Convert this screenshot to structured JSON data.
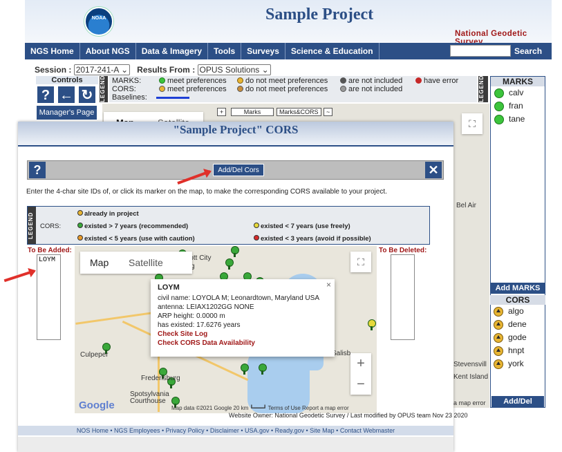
{
  "header": {
    "title": "Sample Project",
    "subtitle": "National Geodetic Survey",
    "logo_text": "NOAA"
  },
  "nav": {
    "items": [
      "NGS Home",
      "About NGS",
      "Data & Imagery",
      "Tools",
      "Surveys",
      "Science & Education"
    ],
    "search_label": "Search"
  },
  "session": {
    "label": "Session :",
    "value": "2017-241-A",
    "results_label": "Results From :",
    "results_value": "OPUS Solutions"
  },
  "controls": {
    "title": "Controls",
    "help": "?",
    "back": "←",
    "refresh": "↻",
    "manager": "Manager's Page"
  },
  "legend": {
    "strip": "LEGEND",
    "marks_label": "MARKS:",
    "cors_label": "CORS:",
    "baselines_label": "Baselines:",
    "meet": "meet preferences",
    "not_meet": "do not meet preferences",
    "not_included": "are not included",
    "have_error": "have error"
  },
  "bg_map": {
    "chips": [
      "+",
      "Marks",
      "Marks&CORS",
      "~"
    ],
    "map_tab": "Map",
    "satellite_tab": "Satellite",
    "labels": [
      "Bel Air",
      "Stevensvill",
      "Kent Island"
    ],
    "report": "a map error"
  },
  "marks_panel": {
    "marks_title": "MARKS",
    "marks": [
      "calv",
      "fran",
      "tane"
    ],
    "add_marks": "Add MARKS",
    "cors_title": "CORS",
    "cors": [
      "algo",
      "dene",
      "gode",
      "hnpt",
      "york"
    ],
    "add_del_cors": "Add/Del CORS"
  },
  "modal": {
    "title": "\"Sample Project\" CORS",
    "help": "?",
    "close": "✕",
    "add_del_button": "Add/Del Cors",
    "instruction": "Enter the 4-char site IDs of, or click its marker on the map, to make the corresponding CORS available to your project.",
    "legend_strip": "LEGEND",
    "legend_cors": "CORS:",
    "already": "already in project",
    "gt7": "existed > 7 years (recommended)",
    "lt7": "existed < 7 years (use freely)",
    "lt5": "existed < 5 years (use with caution)",
    "lt3": "existed < 3 years (avoid if possible)",
    "to_be_added": "To Be Added:",
    "to_be_added_value": "LOYM",
    "to_be_deleted": "To Be Deleted:",
    "owner_line": "Website Owner: National Geodetic Survey  /  Last modified by OPUS team Nov 23 2020",
    "footer_links": "NOS Home  •  NGS Employees  •  Privacy Policy  •  Disclaimer  •  USA.gov  •  Ready.gov  •  Site Map  •  Contact Webmaster"
  },
  "modal_map": {
    "map_tab": "Map",
    "satellite_tab": "Satellite",
    "fullscreen": "⛶",
    "zoom_in": "+",
    "zoom_out": "−",
    "google": "Google",
    "places": [
      "Ellicott City",
      "altsburg",
      "Culpeper",
      "Frederisburg",
      "Spotsylvania Courthouse",
      "Salisb"
    ],
    "footer": "Map data ©2021 Google   20 km ┗━━━┛   Terms of Use   Report a map error",
    "info": {
      "close": "×",
      "id": "LOYM",
      "civil": "civil name:   LOYOLA M; Leonardtown, Maryland USA",
      "antenna": "antenna:       LEIAX1202GG  NONE",
      "arp": "ARP height:  0.0000 m",
      "existed": "has existed: 17.6276 years",
      "site_log": "Check Site Log",
      "availability": "Check CORS Data Availability"
    }
  },
  "colors": {
    "brand": "#2c4f86",
    "accent_red": "#a01818",
    "arrow": "#e0302a",
    "green": "#3cc43c",
    "cors_gold": "#e8b533"
  }
}
